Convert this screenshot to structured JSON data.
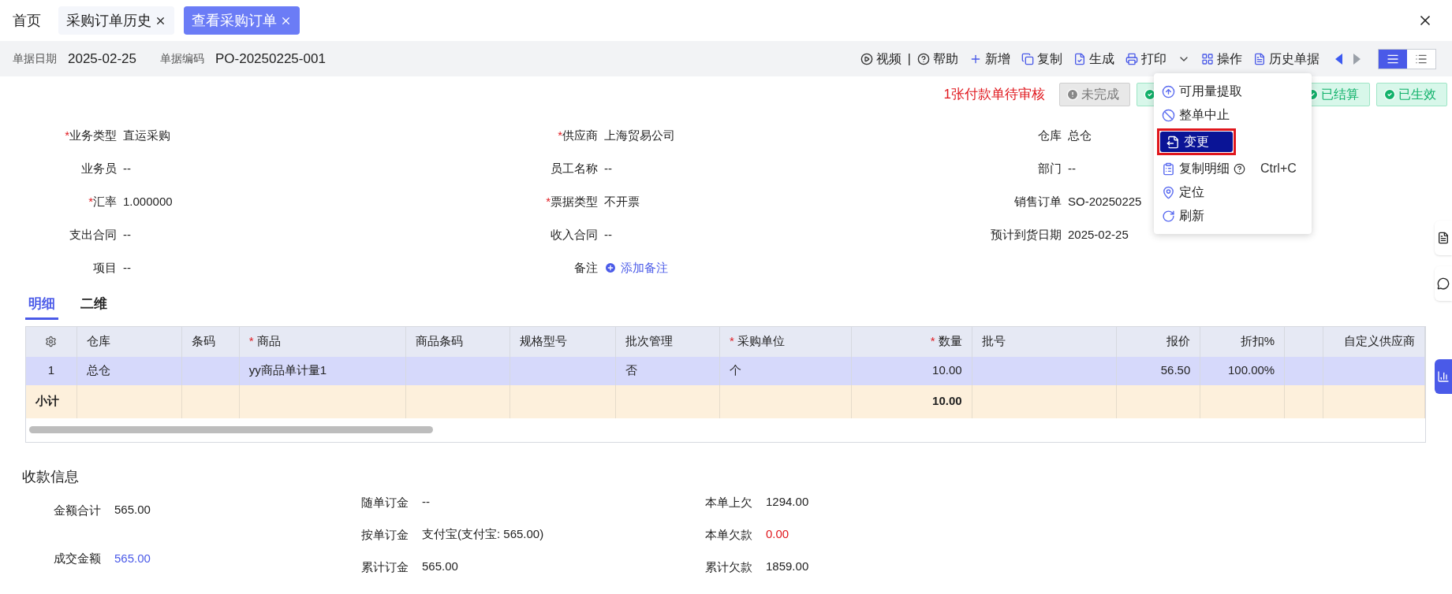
{
  "tabs": [
    {
      "label": "首页",
      "closable": false,
      "selected": false
    },
    {
      "label": "采购订单历史",
      "closable": true,
      "selected": false
    },
    {
      "label": "查看采购订单",
      "closable": true,
      "selected": true
    }
  ],
  "header": {
    "fields": [
      {
        "label": "单据日期",
        "value": "2025-02-25"
      },
      {
        "label": "单据编码",
        "value": "PO-20250225-001"
      }
    ]
  },
  "toolbar": {
    "items": [
      {
        "kind": "video",
        "label": "视频"
      },
      {
        "kind": "separator",
        "label": "|"
      },
      {
        "kind": "help",
        "label": "帮助"
      },
      {
        "kind": "add",
        "label": "新增"
      },
      {
        "kind": "copy",
        "label": "复制"
      },
      {
        "kind": "generate",
        "label": "生成"
      },
      {
        "kind": "print",
        "label": "打印"
      },
      {
        "kind": "caret"
      },
      {
        "kind": "operate",
        "label": "操作"
      },
      {
        "kind": "history",
        "label": "历史单据"
      }
    ],
    "nav": [
      {
        "disabled": false
      },
      {
        "disabled": true
      }
    ],
    "view_toggle": [
      {
        "kind": "list",
        "selected": true
      },
      {
        "kind": "detail",
        "selected": false
      }
    ]
  },
  "status": {
    "alert": "1张付款单待审核",
    "badges": [
      {
        "label": "未完成",
        "done": false
      },
      {
        "done": true
      },
      {
        "label": "已结算",
        "done": true
      },
      {
        "label": "已生效",
        "done": true
      }
    ]
  },
  "menu": {
    "items": [
      {
        "kind": "extract",
        "label": "可用量提取",
        "help": false,
        "selected": false
      },
      {
        "kind": "stop",
        "label": "整单中止",
        "help": false,
        "selected": false
      },
      {
        "kind": "change",
        "label": "变更",
        "help": false,
        "selected": true
      },
      {
        "kind": "copy",
        "label": "复制明细",
        "help": true,
        "shortcut": "Ctrl+C",
        "selected": false
      },
      {
        "kind": "locate",
        "label": "定位",
        "help": false,
        "selected": false
      },
      {
        "kind": "refresh",
        "label": "刷新",
        "help": false,
        "selected": false
      }
    ]
  },
  "form": {
    "rows": [
      [
        {
          "mark": "*",
          "label": "业务类型",
          "value": "直运采购"
        },
        {
          "mark": "*",
          "label": "供应商",
          "value": "上海贸易公司"
        },
        {
          "label": "仓库",
          "value": "总仓"
        }
      ],
      [
        {
          "label": "业务员",
          "value": "--"
        },
        {
          "label": "员工名称",
          "value": "--"
        },
        {
          "label": "部门",
          "value": "--"
        }
      ],
      [
        {
          "mark": "*",
          "label": "汇率",
          "value": "1.000000"
        },
        {
          "mark": "*",
          "label": "票据类型",
          "value": "不开票"
        },
        {
          "label": "销售订单",
          "value": "SO-20250225"
        }
      ],
      [
        {
          "label": "支出合同",
          "value": "--"
        },
        {
          "label": "收入合同",
          "value": "--"
        },
        {
          "label": "预计到货日期",
          "value": "2025-02-25"
        }
      ],
      [
        {
          "label": "项目",
          "value": "--"
        },
        {
          "label": "备注",
          "value": "添加备注",
          "kind": "link"
        }
      ]
    ]
  },
  "detail_tabs": [
    {
      "label": "明细",
      "selected": true
    },
    {
      "label": "二维",
      "selected": false
    }
  ],
  "table": {
    "columns": [
      {
        "kind": "settings"
      },
      {
        "kind": "text",
        "label": "仓库"
      },
      {
        "kind": "text",
        "label": "条码"
      },
      {
        "kind": "text",
        "mark": "*",
        "label": "商品"
      },
      {
        "kind": "text",
        "label": "商品条码"
      },
      {
        "kind": "text",
        "label": "规格型号"
      },
      {
        "kind": "text",
        "label": "批次管理"
      },
      {
        "kind": "text",
        "mark": "*",
        "label": "采购单位"
      },
      {
        "kind": "text",
        "mark": "*",
        "label": "数量"
      },
      {
        "kind": "text",
        "label": "批号"
      },
      {
        "kind": "text",
        "label": "报价"
      },
      {
        "kind": "text",
        "label": "折扣%"
      },
      {
        "kind": "blank"
      },
      {
        "kind": "text",
        "label": "自定义供应商"
      }
    ],
    "rows": [
      {
        "selected": true,
        "cells": [
          "1",
          "总仓",
          null,
          "yy商品单计量1",
          null,
          null,
          "否",
          "个",
          "10.00",
          null,
          "56.50",
          "100.00%",
          null,
          null
        ]
      }
    ],
    "subtotal": {
      "cells": [
        "小计",
        null,
        null,
        null,
        null,
        null,
        null,
        null,
        "10.00",
        null,
        null,
        null,
        null,
        null
      ]
    }
  },
  "payment": {
    "title": "收款信息",
    "columns": [
      [
        {
          "label": "金额合计",
          "value": "565.00",
          "kind": "normal"
        },
        {
          "label": "成交金额",
          "value": "565.00",
          "kind": "link"
        }
      ],
      [
        {
          "label": "随单订金",
          "value": "--",
          "kind": "normal"
        },
        {
          "label": "按单订金",
          "value": "支付宝(支付宝: 565.00)",
          "kind": "normal"
        },
        {
          "label": "累计订金",
          "value": "565.00",
          "kind": "normal"
        }
      ],
      [
        {
          "label": "本单上欠",
          "value": "1294.00",
          "kind": "normal"
        },
        {
          "label": "本单欠款",
          "value": "0.00",
          "kind": "negative"
        },
        {
          "label": "累计欠款",
          "value": "1859.00",
          "kind": "normal"
        }
      ]
    ]
  }
}
